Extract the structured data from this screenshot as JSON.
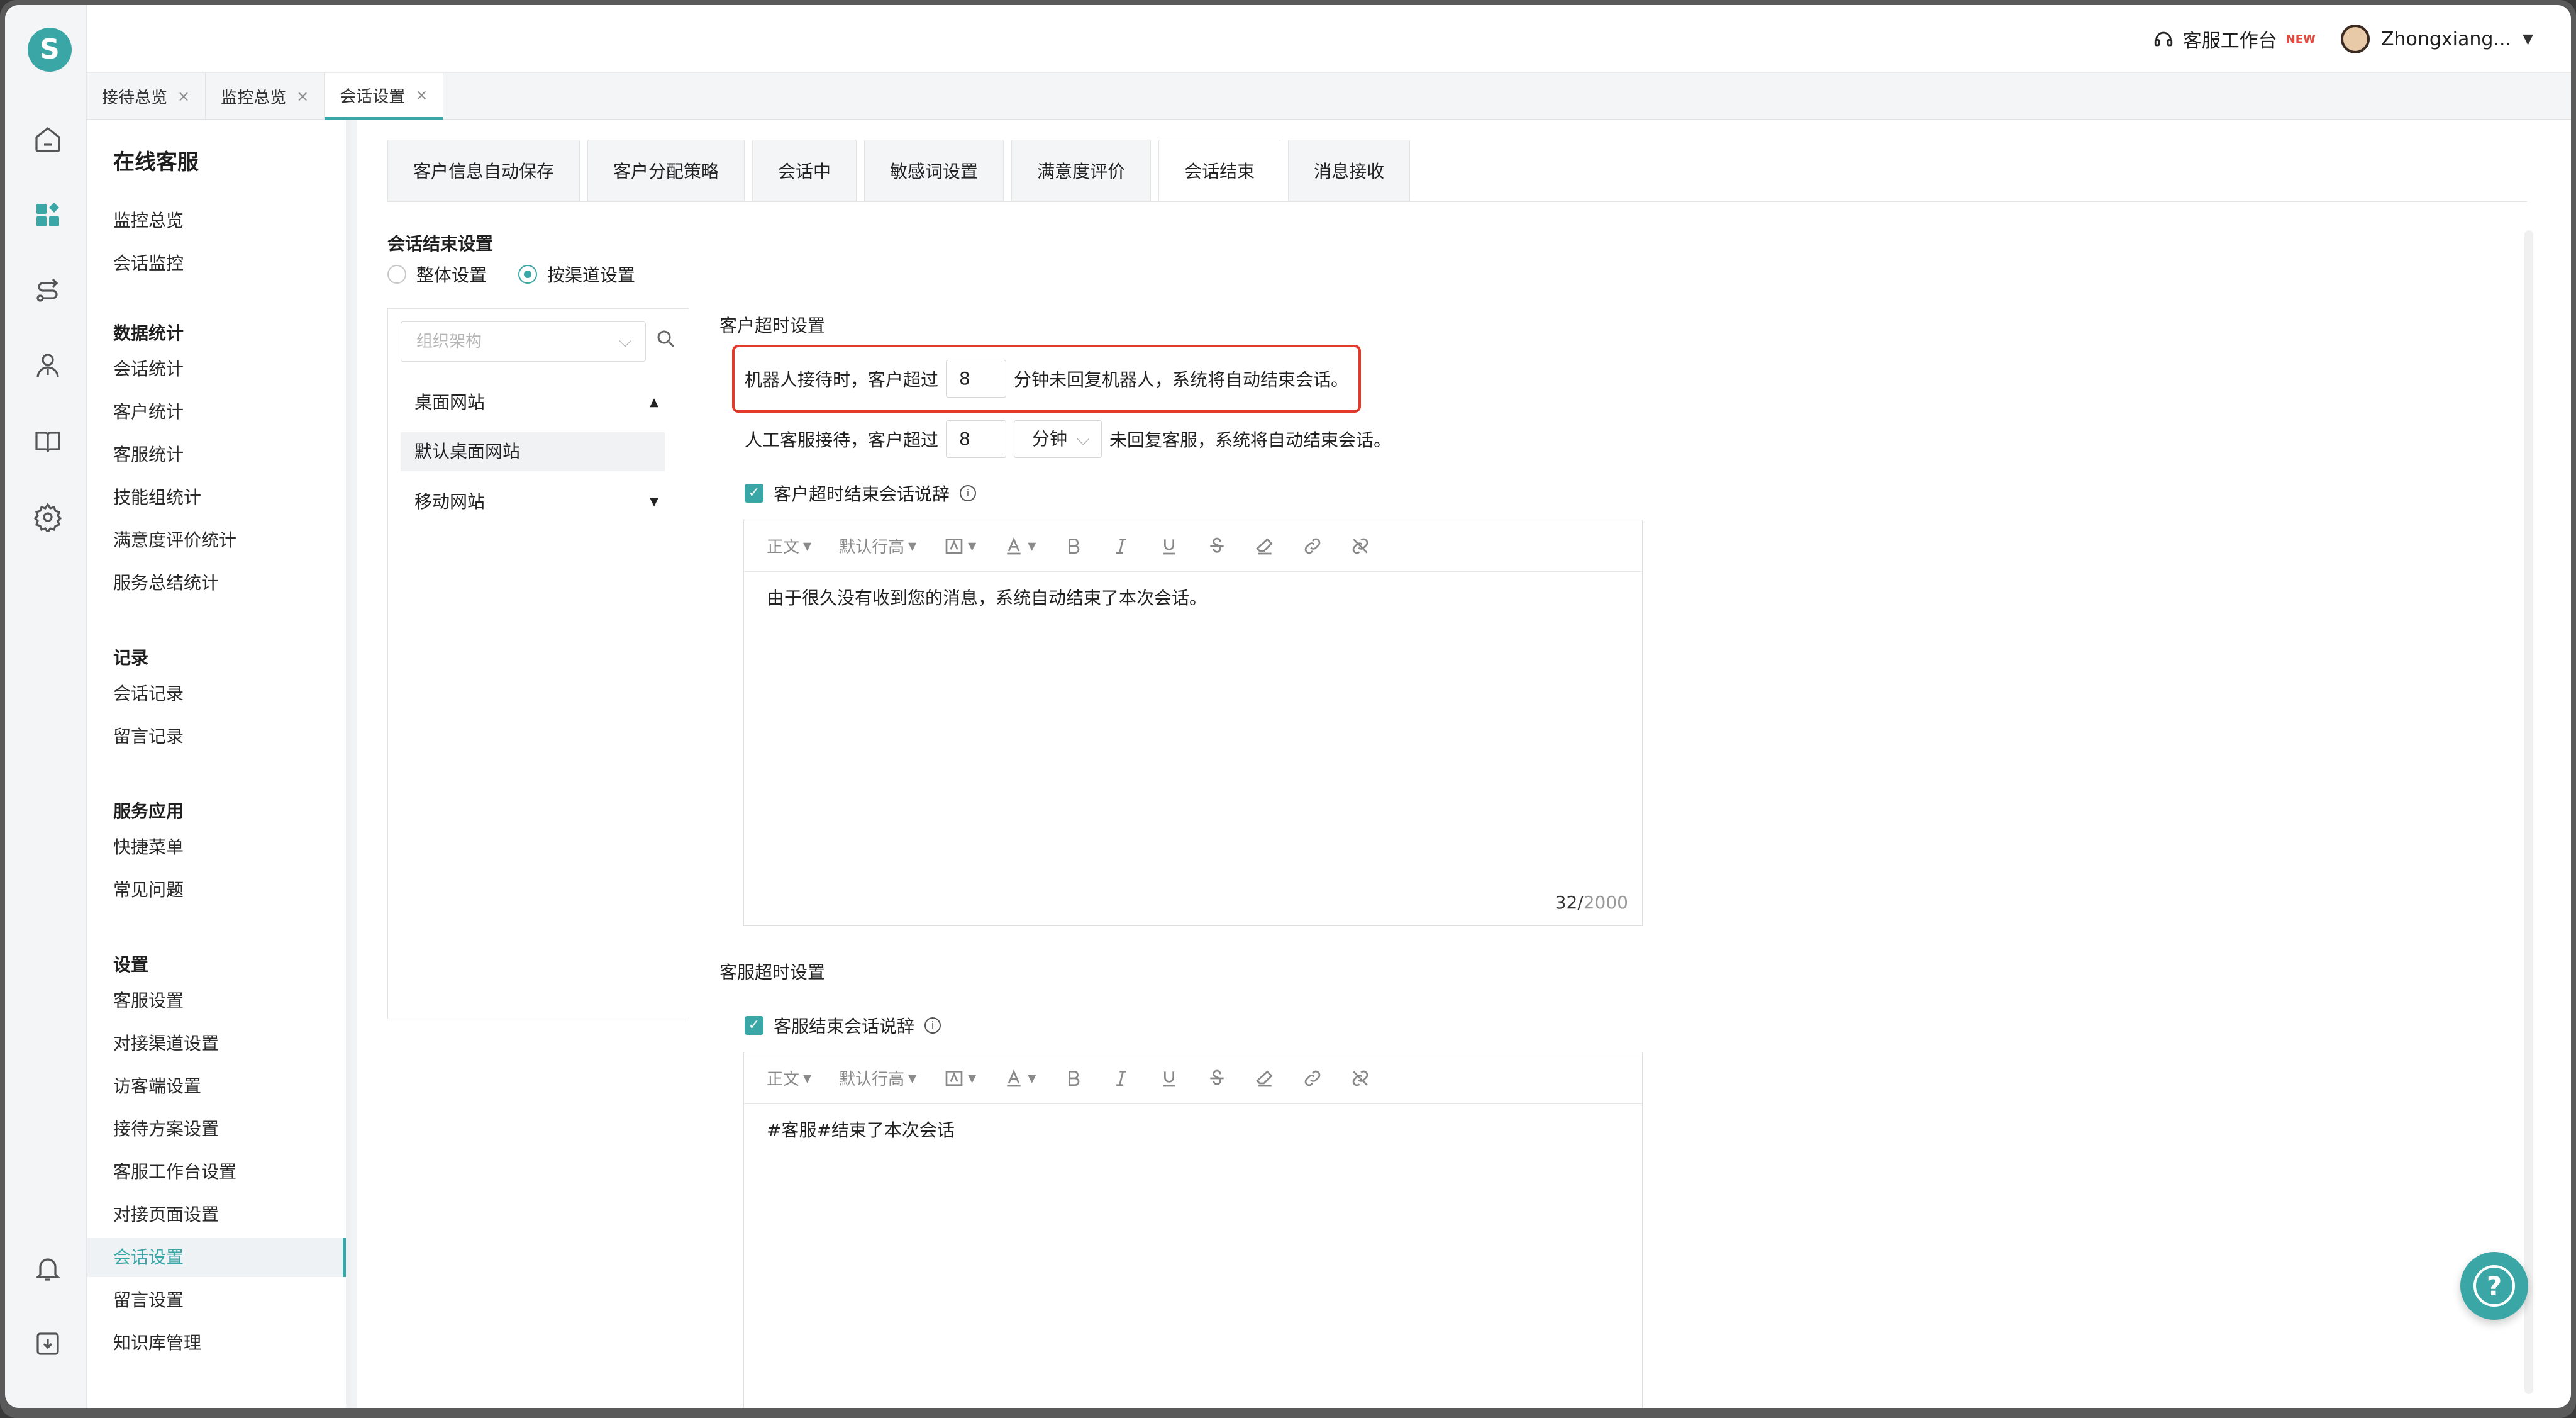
{
  "topbar": {
    "workbench_label": "客服工作台",
    "new_badge": "NEW",
    "username": "Zhongxiang..."
  },
  "page_tabs": [
    {
      "label": "接待总览"
    },
    {
      "label": "监控总览"
    },
    {
      "label": "会话设置"
    }
  ],
  "sidebar": {
    "title": "在线客服",
    "items_top": [
      "监控总览",
      "会话监控"
    ],
    "group_stats": "数据统计",
    "items_stats": [
      "会话统计",
      "客户统计",
      "客服统计",
      "技能组统计",
      "满意度评价统计",
      "服务总结统计"
    ],
    "group_records": "记录",
    "items_records": [
      "会话记录",
      "留言记录"
    ],
    "group_apps": "服务应用",
    "items_apps": [
      "快捷菜单",
      "常见问题"
    ],
    "group_settings": "设置",
    "items_settings": [
      "客服设置",
      "对接渠道设置",
      "访客端设置",
      "接待方案设置",
      "客服工作台设置",
      "对接页面设置",
      "会话设置",
      "留言设置",
      "知识库管理"
    ]
  },
  "setting_tabs": [
    "客户信息自动保存",
    "客户分配策略",
    "会话中",
    "敏感词设置",
    "满意度评价",
    "会话结束",
    "消息接收"
  ],
  "section": {
    "title": "会话结束设置",
    "radio_overall": "整体设置",
    "radio_by_channel": "按渠道设置"
  },
  "channels": {
    "search_placeholder": "组织架构",
    "nodes": [
      "桌面网站",
      "默认桌面网站",
      "移动网站"
    ]
  },
  "customer_timeout": {
    "title": "客户超时设置",
    "robot_prefix": "机器人接待时，客户超过",
    "robot_value": "8",
    "robot_suffix": "分钟未回复机器人，系统将自动结束会话。",
    "agent_prefix": "人工客服接待，客户超过",
    "agent_value": "8",
    "agent_unit": "分钟",
    "agent_suffix": "未回复客服，系统将自动结束会话。",
    "check_label": "客户超时结束会话说辞",
    "editor_text": "由于很久没有收到您的消息，系统自动结束了本次会话。",
    "count": "32/",
    "count_max": "2000"
  },
  "agent_timeout": {
    "title": "客服超时设置",
    "check_label": "客服结束会话说辞",
    "editor_text": "#客服#结束了本次会话"
  },
  "toolbar": {
    "para": "正文",
    "line_height": "默认行高"
  },
  "colors": {
    "accent": "#3aa6a6",
    "highlight": "#e23a2b"
  }
}
